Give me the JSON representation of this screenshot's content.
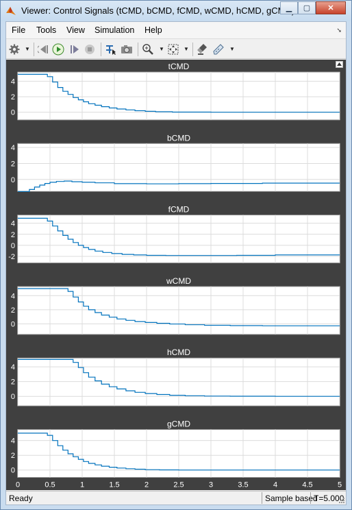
{
  "window": {
    "title": "Viewer: Control Signals (tCMD, bCMD, fCMD, wCMD, hCMD, gCMD)"
  },
  "menu": [
    "File",
    "Tools",
    "View",
    "Simulation",
    "Help"
  ],
  "toolbar": [
    {
      "icon": "gear-icon"
    },
    {
      "icon": "step-back-icon"
    },
    {
      "icon": "run-icon"
    },
    {
      "icon": "step-forward-icon"
    },
    {
      "icon": "stop-icon"
    },
    {
      "icon": "signal-selector-icon"
    },
    {
      "icon": "camera-icon"
    },
    {
      "icon": "zoom-in-icon"
    },
    {
      "icon": "fit-to-view-icon"
    },
    {
      "icon": "highlight-icon"
    },
    {
      "icon": "measure-icon"
    }
  ],
  "colors": {
    "background": "#404040",
    "axes": "#ffffff",
    "grid": "#dcdcdc",
    "line": "#0072bd",
    "text": "#ffffff"
  },
  "chart_data": [
    {
      "type": "line",
      "title": "tCMD",
      "xlim": [
        0,
        5
      ],
      "ylim": [
        -1,
        5.2
      ],
      "yticks": [
        0,
        2,
        4
      ],
      "grid": true,
      "step": true,
      "x": [
        0,
        0.38,
        0.46,
        0.54,
        0.62,
        0.7,
        0.78,
        0.86,
        0.94,
        1.02,
        1.1,
        1.2,
        1.3,
        1.42,
        1.54,
        1.68,
        1.82,
        1.98,
        2.14,
        2.4,
        3.0,
        5.0
      ],
      "y": [
        4.9,
        4.9,
        4.6,
        3.9,
        3.2,
        2.7,
        2.3,
        1.9,
        1.6,
        1.35,
        1.1,
        0.9,
        0.72,
        0.55,
        0.42,
        0.3,
        0.2,
        0.12,
        0.06,
        0.02,
        0.0,
        0.0
      ]
    },
    {
      "type": "line",
      "title": "bCMD",
      "xlim": [
        0,
        5
      ],
      "ylim": [
        -1.5,
        4.5
      ],
      "yticks": [
        0,
        2,
        4
      ],
      "grid": true,
      "step": true,
      "x": [
        0,
        0.1,
        0.18,
        0.26,
        0.34,
        0.42,
        0.5,
        0.6,
        0.72,
        0.84,
        1.0,
        1.2,
        1.5,
        2.0,
        2.5,
        3.0,
        3.8,
        5.0
      ],
      "y": [
        -1.5,
        -1.5,
        -1.25,
        -0.95,
        -0.7,
        -0.5,
        -0.35,
        -0.25,
        -0.2,
        -0.28,
        -0.35,
        -0.42,
        -0.52,
        -0.55,
        -0.52,
        -0.5,
        -0.45,
        -0.45
      ]
    },
    {
      "type": "line",
      "title": "fCMD",
      "xlim": [
        0,
        5
      ],
      "ylim": [
        -3.2,
        5.5
      ],
      "yticks": [
        -2,
        0,
        2,
        4
      ],
      "grid": true,
      "step": true,
      "x": [
        0,
        0.38,
        0.46,
        0.54,
        0.62,
        0.7,
        0.78,
        0.86,
        0.94,
        1.02,
        1.1,
        1.2,
        1.32,
        1.46,
        1.62,
        1.8,
        2.0,
        2.3,
        2.8,
        3.4,
        4.0,
        5.0
      ],
      "y": [
        4.9,
        4.9,
        4.4,
        3.5,
        2.6,
        1.8,
        1.1,
        0.5,
        0.0,
        -0.4,
        -0.75,
        -1.05,
        -1.3,
        -1.5,
        -1.65,
        -1.75,
        -1.82,
        -1.85,
        -1.85,
        -1.82,
        -1.75,
        -1.75
      ]
    },
    {
      "type": "line",
      "title": "wCMD",
      "xlim": [
        0,
        5
      ],
      "ylim": [
        -1.5,
        5.3
      ],
      "yticks": [
        0,
        2,
        4
      ],
      "grid": true,
      "step": true,
      "x": [
        0,
        0.7,
        0.78,
        0.86,
        0.94,
        1.02,
        1.1,
        1.2,
        1.3,
        1.42,
        1.54,
        1.68,
        1.82,
        1.98,
        2.16,
        2.36,
        2.6,
        2.9,
        3.3,
        3.8,
        4.4,
        5.0
      ],
      "y": [
        5.0,
        5.0,
        4.6,
        3.8,
        3.1,
        2.5,
        2.0,
        1.6,
        1.25,
        0.95,
        0.7,
        0.5,
        0.33,
        0.2,
        0.08,
        -0.02,
        -0.12,
        -0.2,
        -0.25,
        -0.28,
        -0.28,
        -0.28
      ]
    },
    {
      "type": "line",
      "title": "hCMD",
      "xlim": [
        0,
        5
      ],
      "ylim": [
        -1.3,
        5.2
      ],
      "yticks": [
        0,
        2,
        4
      ],
      "grid": true,
      "step": true,
      "x": [
        0,
        0.78,
        0.86,
        0.94,
        1.02,
        1.1,
        1.2,
        1.3,
        1.42,
        1.54,
        1.68,
        1.82,
        1.98,
        2.16,
        2.36,
        2.6,
        2.9,
        3.3,
        4.0,
        5.0
      ],
      "y": [
        5.0,
        5.0,
        4.6,
        3.9,
        3.2,
        2.6,
        2.1,
        1.65,
        1.3,
        1.0,
        0.75,
        0.55,
        0.38,
        0.25,
        0.15,
        0.08,
        0.04,
        0.02,
        0.0,
        0.0
      ]
    },
    {
      "type": "line",
      "title": "gCMD",
      "xlim": [
        0,
        5
      ],
      "ylim": [
        -1,
        5.5
      ],
      "yticks": [
        0,
        2,
        4
      ],
      "grid": true,
      "step": true,
      "x": [
        0,
        0.38,
        0.46,
        0.54,
        0.62,
        0.7,
        0.78,
        0.86,
        0.94,
        1.02,
        1.1,
        1.2,
        1.3,
        1.42,
        1.54,
        1.68,
        1.82,
        1.98,
        2.2,
        2.5,
        3.0,
        5.0
      ],
      "y": [
        5.0,
        5.0,
        4.7,
        4.0,
        3.3,
        2.7,
        2.2,
        1.8,
        1.45,
        1.15,
        0.9,
        0.7,
        0.52,
        0.38,
        0.27,
        0.18,
        0.11,
        0.05,
        0.02,
        0.0,
        0.0,
        0.0
      ]
    }
  ],
  "xaxis": {
    "ticks": [
      0,
      0.5,
      1,
      1.5,
      2,
      2.5,
      3,
      3.5,
      4,
      4.5,
      5
    ]
  },
  "status": {
    "ready": "Ready",
    "mode": "Sample based",
    "time": "T=5.000"
  }
}
